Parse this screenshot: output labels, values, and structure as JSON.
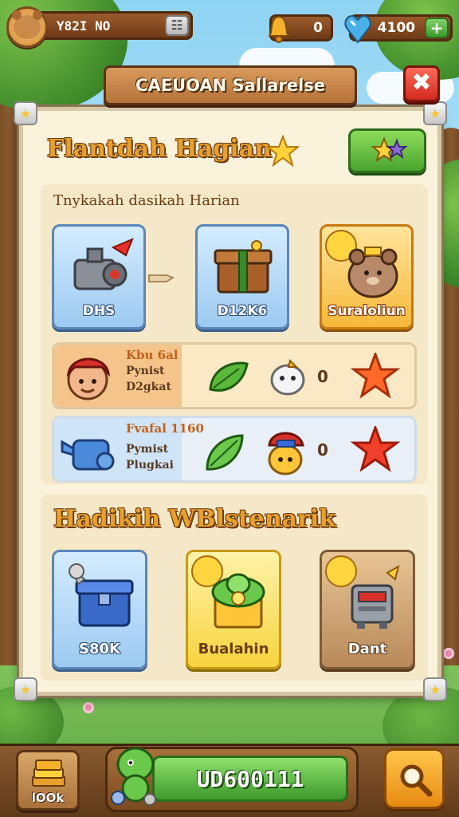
{
  "player": {
    "name": "Y82I NO"
  },
  "resources": {
    "bell": {
      "value": "0"
    },
    "gem": {
      "value": "4100"
    }
  },
  "header": {
    "title": "CAEUOAN Sallarelse"
  },
  "daily": {
    "title": "Flantdah Hagian",
    "subtitle": "Tnykakah dasikah Harian",
    "cards": [
      {
        "label": "DHS"
      },
      {
        "label": "D12K6"
      },
      {
        "label": "Suraloliun"
      }
    ],
    "rows": [
      {
        "title": "Kbu 6al",
        "line1": "Pynist",
        "line2": "D2gkat",
        "value": "0"
      },
      {
        "title": "Fvafal 1160",
        "line1": "Pymist",
        "line2": "Plugkai",
        "value": "0"
      }
    ]
  },
  "rewards": {
    "title": "Hadikih WBlstenarik",
    "cards": [
      {
        "label": "S80K"
      },
      {
        "label": "Bualahin"
      },
      {
        "label": "Dant"
      }
    ]
  },
  "bottom": {
    "book_label": "lOOk",
    "main_label": "UD600111"
  },
  "colors": {
    "accent": "#e8a02a",
    "panel": "#fbf2dc",
    "green": "#4aa52e",
    "close": "#d12a1e"
  }
}
